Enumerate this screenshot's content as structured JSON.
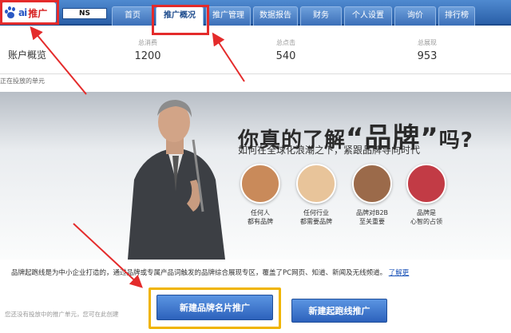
{
  "header": {
    "logo_text": "ai",
    "logo_suffix": "推广",
    "user_badge": "NS",
    "tabs": [
      {
        "label": "首页"
      },
      {
        "label": "推广概况"
      },
      {
        "label": "推广管理"
      },
      {
        "label": "数据报告"
      },
      {
        "label": "财务"
      },
      {
        "label": "个人设置"
      },
      {
        "label": "询价"
      },
      {
        "label": "排行榜"
      }
    ],
    "active_tab": "推广概况"
  },
  "overview": {
    "title": "账户概览",
    "stats": [
      {
        "label": "总消费",
        "value": "1200"
      },
      {
        "label": "总点击",
        "value": "540"
      },
      {
        "label": "总展现",
        "value": "953"
      }
    ]
  },
  "notice": "正在投放的单元",
  "banner": {
    "headline_pre": "你真的了解",
    "headline_brand": "“品牌”",
    "headline_post": "吗?",
    "subhead": "如何在全球化浪潮之下，紧跟品牌导向时代",
    "circles": [
      {
        "caption": "任何人\n都有品牌",
        "color": "#c98a5a"
      },
      {
        "caption": "任何行业\n都需要品牌",
        "color": "#e8c49a"
      },
      {
        "caption": "品牌对B2B\n至关重要",
        "color": "#9b6a4a"
      },
      {
        "caption": "品牌是\n心智的占领",
        "color": "#c23b45"
      }
    ]
  },
  "description": {
    "text": "品牌起跑线是为中小企业打造的，通过品牌或专属产品词触发的品牌综合展现专区，覆盖了PC网页、知道、新闻及无线频道。",
    "link": "了解更"
  },
  "hint": "您还没有投放中的推广单元，您可在此创建",
  "buttons": {
    "primary": "新建品牌名片推广",
    "secondary": "新建起跑线推广"
  },
  "colors": {
    "nav_blue": "#2a5fa8",
    "annotation_red": "#e42b2b",
    "highlight_yellow": "#f0b400",
    "button_blue": "#2d62bc"
  }
}
